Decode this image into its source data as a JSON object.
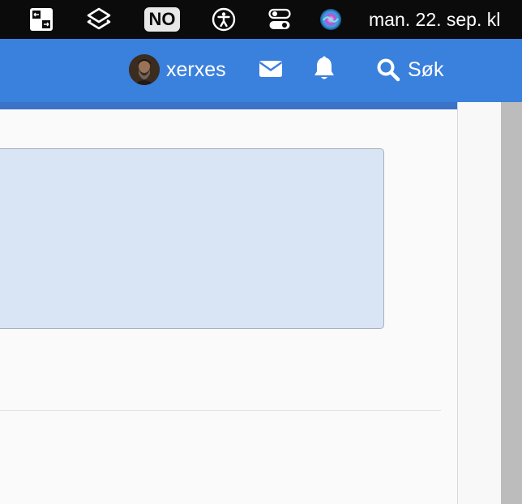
{
  "menubar": {
    "icons": [
      "window-switcher-icon",
      "shortcuts-layers-icon",
      "accessibility-icon",
      "control-center-icon",
      "siri-icon"
    ],
    "input_source": "NO",
    "clock": "man. 22. sep. kl"
  },
  "header": {
    "username": "xerxes",
    "icons": [
      "avatar",
      "envelope-icon",
      "bell-icon",
      "search-icon"
    ],
    "search_label": "Søk",
    "color": "#3a80dd"
  },
  "colors": {
    "info_box_bg": "#d9e5f5",
    "info_box_border": "#a6b0be",
    "page_bg": "#fafafa",
    "menubar_bg": "#0b0b0b"
  }
}
